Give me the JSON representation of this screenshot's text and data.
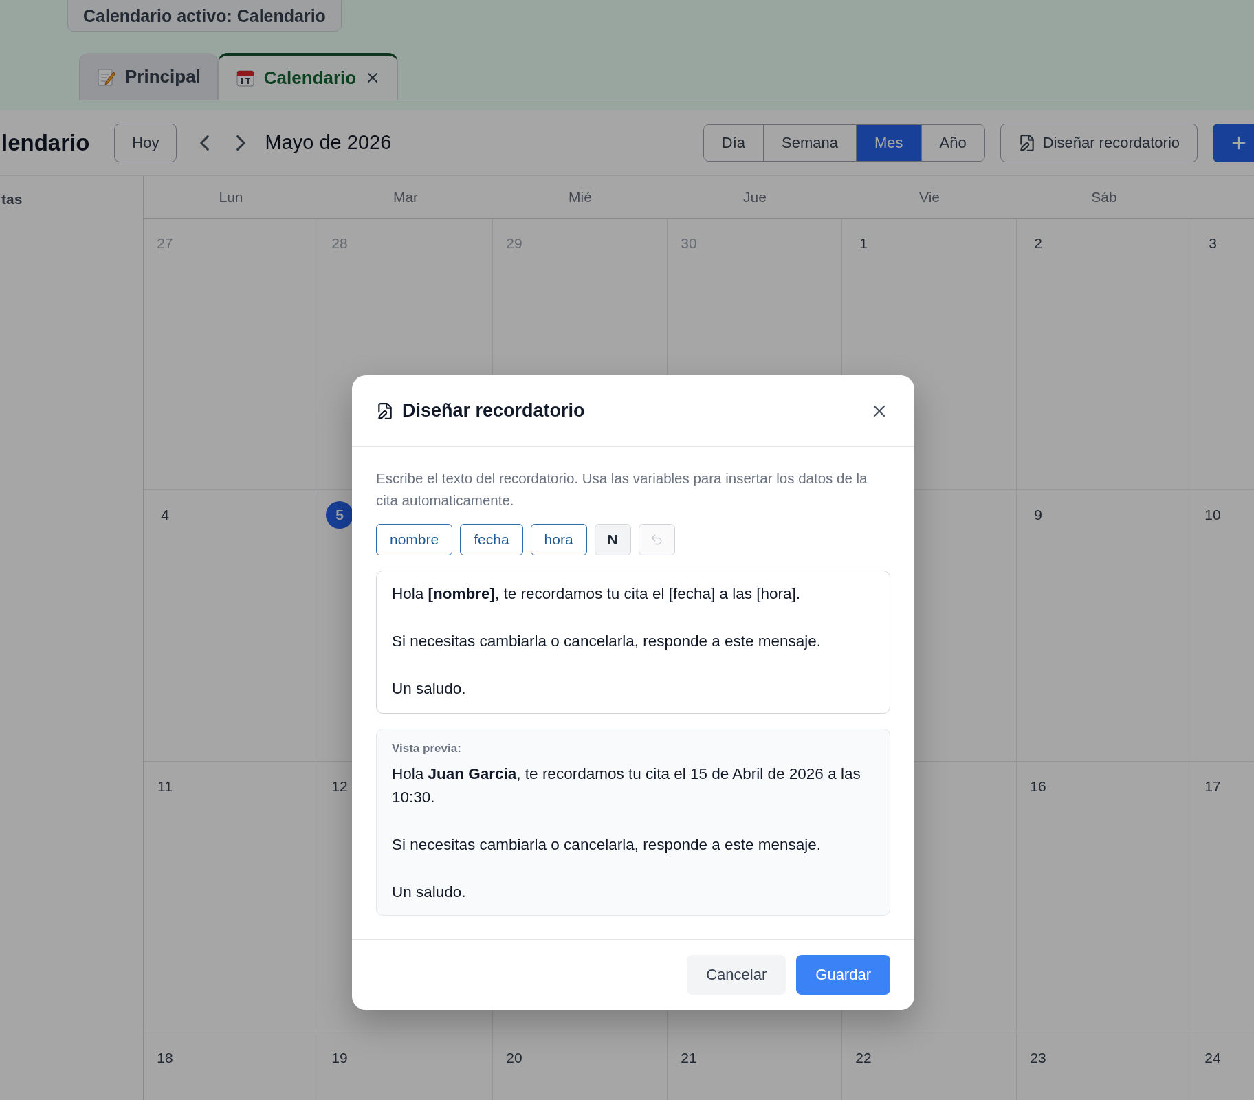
{
  "active_calendar_badge": "Calendario activo: Calendario",
  "tabs": [
    {
      "label": "Principal",
      "kind": "notes",
      "selected": false,
      "closable": false
    },
    {
      "label": "Calendario",
      "kind": "calendar",
      "selected": true,
      "closable": true
    }
  ],
  "toolbar": {
    "title": "lendario",
    "today_button": "Hoy",
    "month": "Mayo de 2026",
    "views": [
      {
        "label": "Día",
        "selected": false
      },
      {
        "label": "Semana",
        "selected": false
      },
      {
        "label": "Mes",
        "selected": true
      },
      {
        "label": "Año",
        "selected": false
      }
    ],
    "design_button": "Diseñar recordatorio"
  },
  "sidebar": {
    "heading": "tas"
  },
  "calendar": {
    "weekdays": [
      "Lun",
      "Mar",
      "Mié",
      "Jue",
      "Vie",
      "Sáb"
    ],
    "weeks": [
      {
        "start": [
          {
            "day": "27",
            "other_month": true,
            "today": false
          },
          {
            "day": "28",
            "other_month": true,
            "today": false
          },
          {
            "day": "29",
            "other_month": true,
            "today": false
          },
          {
            "day": "30",
            "other_month": true,
            "today": false
          },
          {
            "day": "1",
            "other_month": false,
            "today": false
          },
          {
            "day": "2",
            "other_month": false,
            "today": false
          },
          {
            "day": "3",
            "other_month": false,
            "today": false
          }
        ]
      },
      {
        "start": [
          {
            "day": "4",
            "other_month": false,
            "today": false
          },
          {
            "day": "5",
            "other_month": false,
            "today": true
          }
        ],
        "end": [
          {
            "day": "9",
            "other_month": false,
            "today": false
          },
          {
            "day": "10",
            "other_month": false,
            "today": false
          }
        ]
      },
      {
        "start": [
          {
            "day": "11",
            "other_month": false,
            "today": false
          },
          {
            "day": "12",
            "other_month": false,
            "today": false
          }
        ],
        "end": [
          {
            "day": "16",
            "other_month": false,
            "today": false
          },
          {
            "day": "17",
            "other_month": false,
            "today": false
          }
        ]
      },
      {
        "start": [
          {
            "day": "18",
            "other_month": false,
            "today": false
          },
          {
            "day": "19",
            "other_month": false,
            "today": false
          },
          {
            "day": "20",
            "other_month": false,
            "today": false
          },
          {
            "day": "21",
            "other_month": false,
            "today": false
          },
          {
            "day": "22",
            "other_month": false,
            "today": false
          },
          {
            "day": "23",
            "other_month": false,
            "today": false
          },
          {
            "day": "24",
            "other_month": false,
            "today": false
          }
        ]
      }
    ]
  },
  "dialog": {
    "title": "Diseñar recordatorio",
    "description": "Escribe el texto del recordatorio. Usa las variables para insertar los datos de la cita automaticamente.",
    "tools": [
      {
        "kind": "variable",
        "label": "nombre",
        "disabled": false
      },
      {
        "kind": "variable",
        "label": "fecha",
        "disabled": false
      },
      {
        "kind": "variable",
        "label": "hora",
        "disabled": false
      },
      {
        "kind": "bold",
        "label": "N",
        "disabled": false
      },
      {
        "kind": "undo",
        "disabled": true
      }
    ],
    "editor_paragraphs": [
      "Hola **[nombre]**, te recordamos tu cita el [fecha] a las [hora].",
      "Si necesitas cambiarla o cancelarla, responde a este mensaje.",
      "Un saludo."
    ],
    "preview_label": "Vista previa:",
    "preview_paragraphs": [
      "Hola **Juan Garcia**, te recordamos tu cita el 15 de Abril de 2026 a las 10:30.",
      "Si necesitas cambiarla o cancelarla, responde a este mensaje.",
      "Un saludo."
    ],
    "cancel_button": "Cancelar",
    "save_button": "Guardar"
  }
}
